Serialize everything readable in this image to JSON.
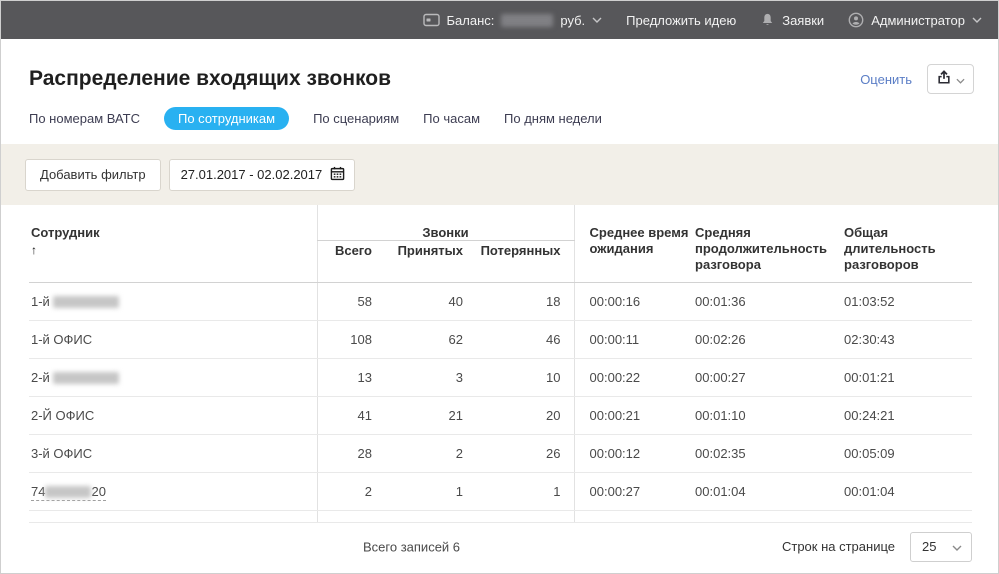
{
  "topbar": {
    "balance_label": "Баланс:",
    "balance_amount_masked": true,
    "currency_label": "руб.",
    "suggest_idea_label": "Предложить идею",
    "tickets_label": "Заявки",
    "user_label": "Администратор"
  },
  "header": {
    "title": "Распределение входящих звонков",
    "rate_link_label": "Оценить"
  },
  "tabs": [
    {
      "label": "По номерам ВАТС",
      "active": false
    },
    {
      "label": "По сотрудникам",
      "active": true
    },
    {
      "label": "По сценариям",
      "active": false
    },
    {
      "label": "По часам",
      "active": false
    },
    {
      "label": "По дням недели",
      "active": false
    }
  ],
  "filters": {
    "add_filter_label": "Добавить фильтр",
    "date_range_value": "27.01.2017 - 02.02.2017"
  },
  "table": {
    "sort_icon": "↑",
    "group_header": "Звонки",
    "headers": [
      "Сотрудник",
      "Всего",
      "Принятых",
      "Потерянных",
      "Среднее время ожидания",
      "Средняя продолжительность разговора",
      "Общая длительность разговоров"
    ],
    "rows": [
      {
        "name_parts": [
          {
            "text": "1-й "
          },
          {
            "masked_width": 66
          }
        ],
        "link": false,
        "values": [
          "58",
          "40",
          "18",
          "00:00:16",
          "00:01:36",
          "01:03:52"
        ]
      },
      {
        "name_parts": [
          {
            "text": "1-й ОФИС"
          }
        ],
        "link": false,
        "values": [
          "108",
          "62",
          "46",
          "00:00:11",
          "00:02:26",
          "02:30:43"
        ]
      },
      {
        "name_parts": [
          {
            "text": "2-й "
          },
          {
            "masked_width": 66
          }
        ],
        "link": false,
        "values": [
          "13",
          "3",
          "10",
          "00:00:22",
          "00:00:27",
          "00:01:21"
        ]
      },
      {
        "name_parts": [
          {
            "text": "2-Й ОФИС"
          }
        ],
        "link": false,
        "values": [
          "41",
          "21",
          "20",
          "00:00:21",
          "00:01:10",
          "00:24:21"
        ]
      },
      {
        "name_parts": [
          {
            "text": "3-й ОФИС"
          }
        ],
        "link": false,
        "values": [
          "28",
          "2",
          "26",
          "00:00:12",
          "00:02:35",
          "00:05:09"
        ]
      },
      {
        "name_parts": [
          {
            "text": "74"
          },
          {
            "masked_width": 46
          },
          {
            "text": "20"
          }
        ],
        "link": true,
        "values": [
          "2",
          "1",
          "1",
          "00:00:27",
          "00:01:04",
          "00:01:04"
        ]
      }
    ]
  },
  "footer": {
    "total_records_label": "Всего записей 6",
    "rows_per_page_label": "Строк на странице",
    "rows_per_page_value": "25"
  },
  "colors": {
    "topbar_bg": "#57575a",
    "accent_tab": "#29b1f1",
    "link_blue": "#5b7ec6",
    "filter_band_bg": "#f2efe8"
  }
}
